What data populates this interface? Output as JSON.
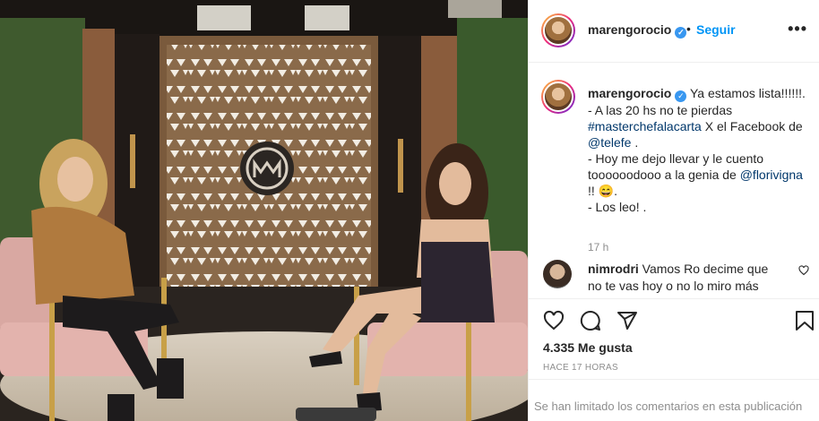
{
  "post": {
    "author": "marengorocio",
    "follow_label": "Seguir",
    "separator": "•",
    "more_label": "•••"
  },
  "caption": {
    "author": "marengorocio",
    "lines": [
      {
        "text": "Ya estamos lista!!!!!!."
      },
      {
        "text": "- A las 20 hs no te pierdas"
      },
      {
        "hashtag": "#masterchefalacarta",
        "text": " X el Facebook de"
      },
      {
        "mention": "@telefe",
        "text": " ."
      },
      {
        "text": "- Hoy me dejo llevar y le cuento"
      },
      {
        "text": "toooooodooo a la genia de ",
        "mention": "@florivigna"
      },
      {
        "text": "!! 😄."
      },
      {
        "text": "- Los leo! ."
      }
    ],
    "time": "17 h"
  },
  "comment": {
    "author": "nimrodri",
    "text": "Vamos Ro decime que no te vas hoy o no lo miro más"
  },
  "actions": {
    "icons": [
      "heart-icon",
      "comment-icon",
      "share-icon",
      "bookmark-icon"
    ],
    "likes": "4.335 Me gusta",
    "posted": "HACE 17 HORAS",
    "limited_notice": "Se han limitado los comentarios en esta publicación"
  },
  "colors": {
    "link": "#00376b",
    "follow": "#0095f6",
    "verified": "#3897f0",
    "muted": "#8e8e8e"
  }
}
